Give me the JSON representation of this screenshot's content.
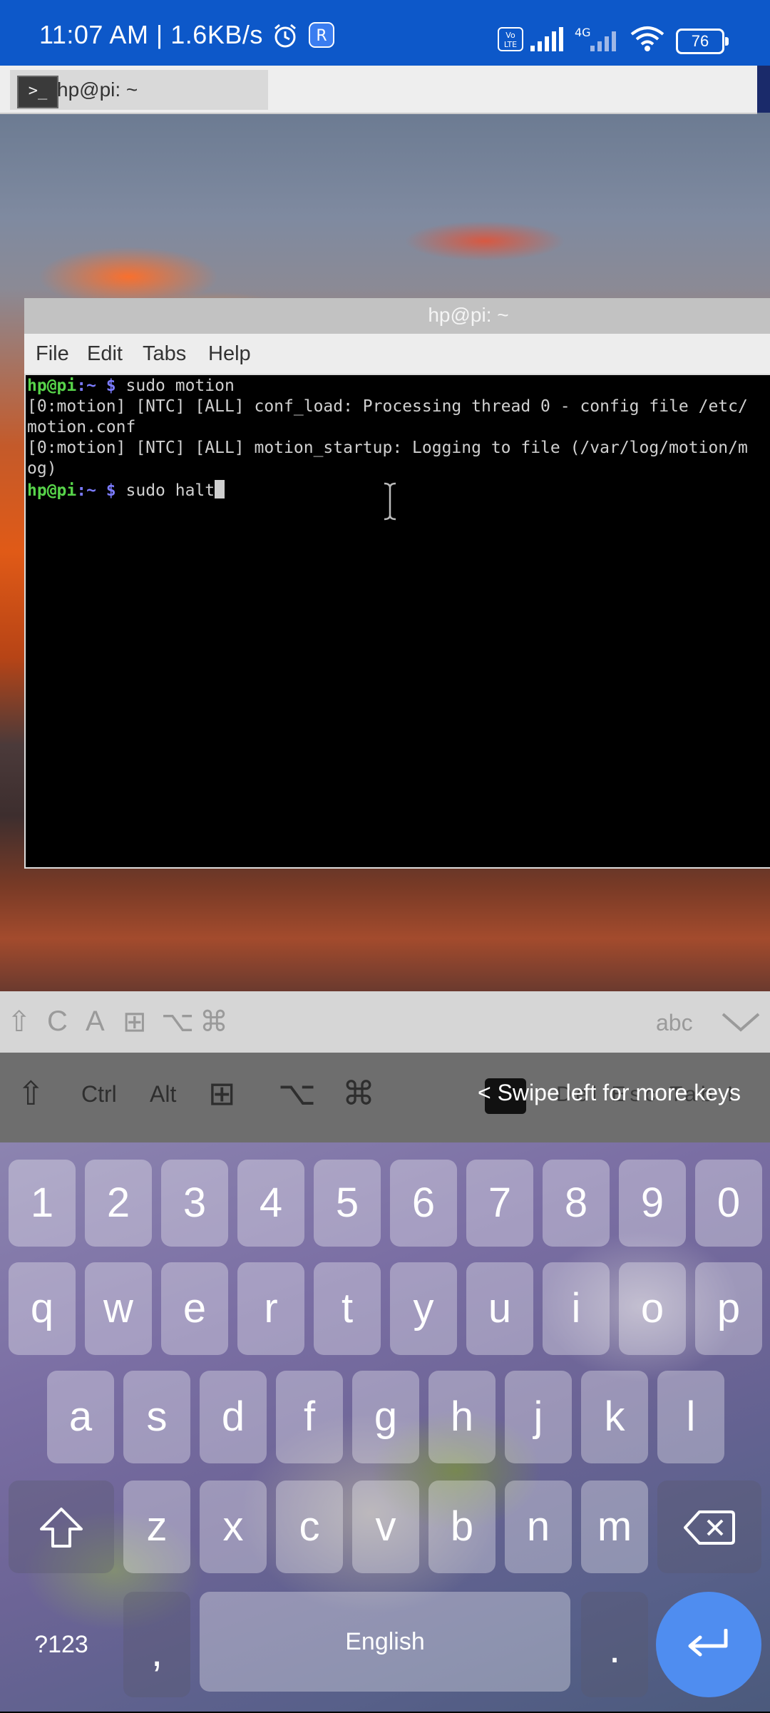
{
  "status_bar": {
    "time_and_speed": "11:07 AM | 1.6KB/s",
    "network": "4G",
    "battery": "76"
  },
  "taskbar": {
    "terminal_icon_text": ">_",
    "window_label": "hp@pi: ~"
  },
  "terminal": {
    "title": "hp@pi: ~",
    "menu": [
      "File",
      "Edit",
      "Tabs",
      "Help"
    ],
    "prompt_user": "hp@pi",
    "prompt_path": ":~",
    "prompt_dollar": " $",
    "line1_cmd": " sudo motion",
    "line2": "[0:motion] [NTC] [ALL] conf_load: Processing thread 0 - config file /etc/",
    "line3": "motion.conf",
    "line4": "[0:motion] [NTC] [ALL] motion_startup: Logging to file (/var/log/motion/m",
    "line5": "og)",
    "line6_cmd": " sudo halt"
  },
  "extra_keys_bar": {
    "symbols": [
      "⇧",
      "C",
      "A",
      "⊞",
      "⌥",
      "⌘"
    ],
    "mode_label": "abc",
    "collapse_icon": "chevron-down"
  },
  "modifier_row": {
    "shift": "⇧",
    "ctrl": "Ctrl",
    "alt": "Alt",
    "win": "⊞",
    "option": "⌥",
    "command": "⌘",
    "swipe_hint": "< Swipe left for more keys",
    "hidden_keys": "Del  Esc  Tab  I"
  },
  "keyboard": {
    "numbers": [
      "1",
      "2",
      "3",
      "4",
      "5",
      "6",
      "7",
      "8",
      "9",
      "0"
    ],
    "row1": [
      "q",
      "w",
      "e",
      "r",
      "t",
      "y",
      "u",
      "i",
      "o",
      "p"
    ],
    "row2": [
      "a",
      "s",
      "d",
      "f",
      "g",
      "h",
      "j",
      "k",
      "l"
    ],
    "row3": [
      "z",
      "x",
      "c",
      "v",
      "b",
      "n",
      "m"
    ],
    "symbols_key": "?123",
    "comma_key": ",",
    "space_label": "English",
    "period_key": "."
  }
}
